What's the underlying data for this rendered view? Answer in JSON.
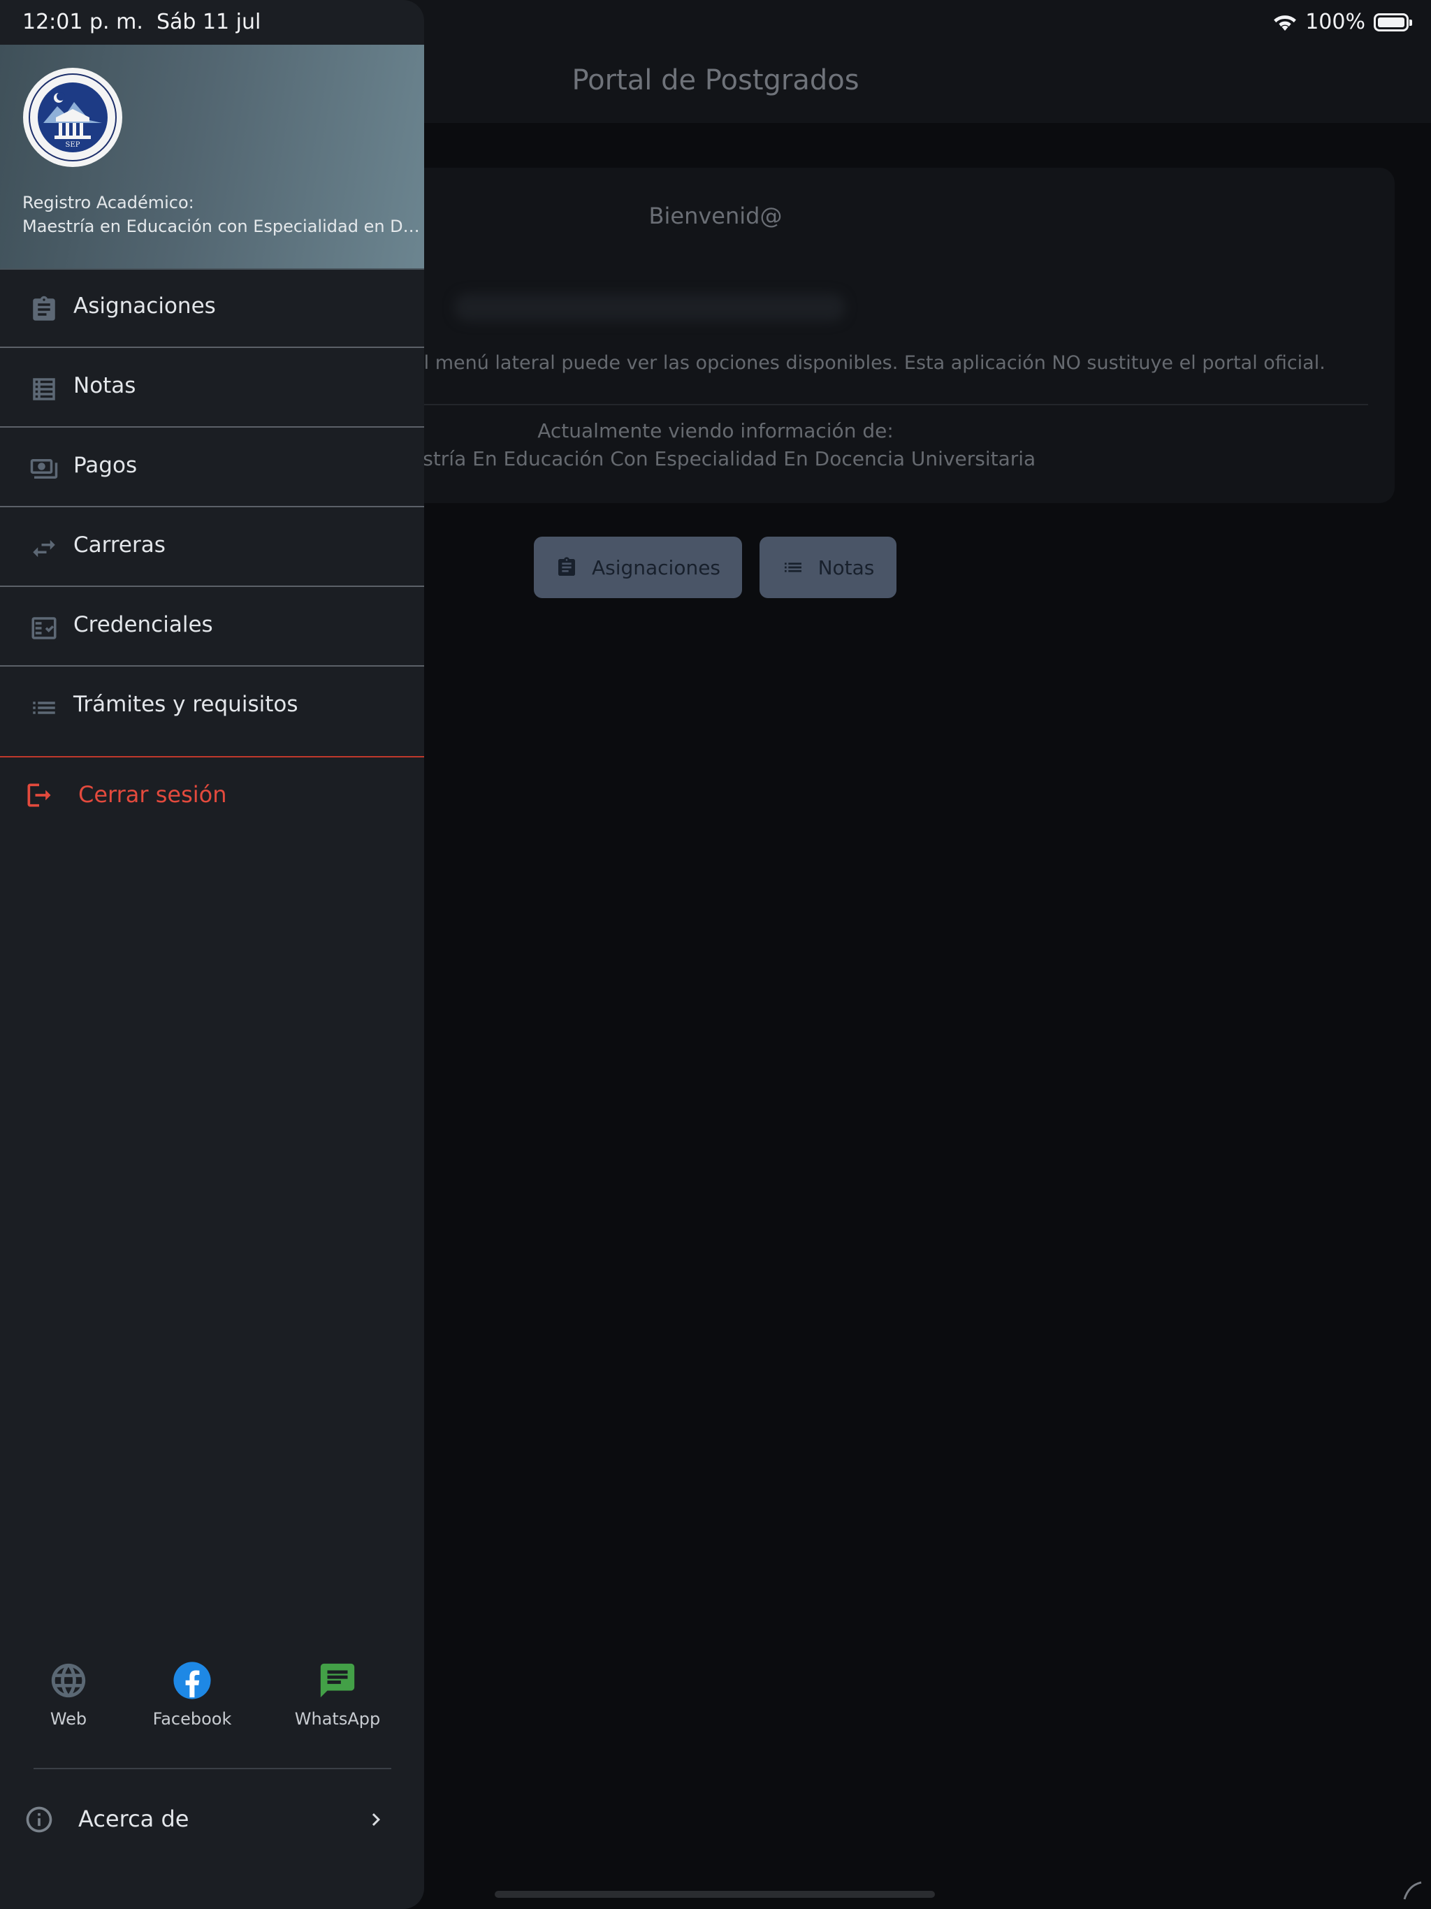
{
  "status_bar": {
    "time": "12:01 p. m.",
    "date": "Sáb 11 jul",
    "battery": "100%"
  },
  "app_bar": {
    "title": "Portal de Postgrados"
  },
  "main": {
    "welcome_title": "Bienvenid@",
    "info_text": "el menú lateral puede ver las opciones disponibles. Esta aplicación NO sustituye el portal oficial.",
    "viewing_label": "Actualmente viendo información de:",
    "viewing_value": "estría En Educación Con Especialidad En Docencia Universitaria",
    "buttons": [
      {
        "label": "Asignaciones",
        "icon": "clipboard-icon"
      },
      {
        "label": "Notas",
        "icon": "list-icon"
      }
    ]
  },
  "drawer": {
    "header": {
      "label": "Registro Académico:",
      "value": "Maestría en Educación con Especialidad en Docencia Universitaria",
      "logo": "SEP"
    },
    "items": [
      {
        "label": "Asignaciones",
        "icon": "clipboard-icon"
      },
      {
        "label": "Notas",
        "icon": "table-icon"
      },
      {
        "label": "Pagos",
        "icon": "payments-icon"
      },
      {
        "label": "Carreras",
        "icon": "swap-icon"
      },
      {
        "label": "Credenciales",
        "icon": "fact-check-icon"
      },
      {
        "label": "Trámites y requisitos",
        "icon": "list-icon"
      }
    ],
    "logout": {
      "label": "Cerrar sesión",
      "icon": "logout-icon"
    },
    "social": [
      {
        "label": "Web",
        "icon": "globe-icon",
        "color": "#5b6874"
      },
      {
        "label": "Facebook",
        "icon": "facebook-icon",
        "color": "#1e88e5"
      },
      {
        "label": "WhatsApp",
        "icon": "chat-icon",
        "color": "#43a047"
      }
    ],
    "about": {
      "label": "Acerca de",
      "icon": "info-icon"
    }
  },
  "colors": {
    "drawer_bg": "#1b1e23",
    "accent_logout": "#e34a3d",
    "page_bg": "#0b0c0f"
  }
}
